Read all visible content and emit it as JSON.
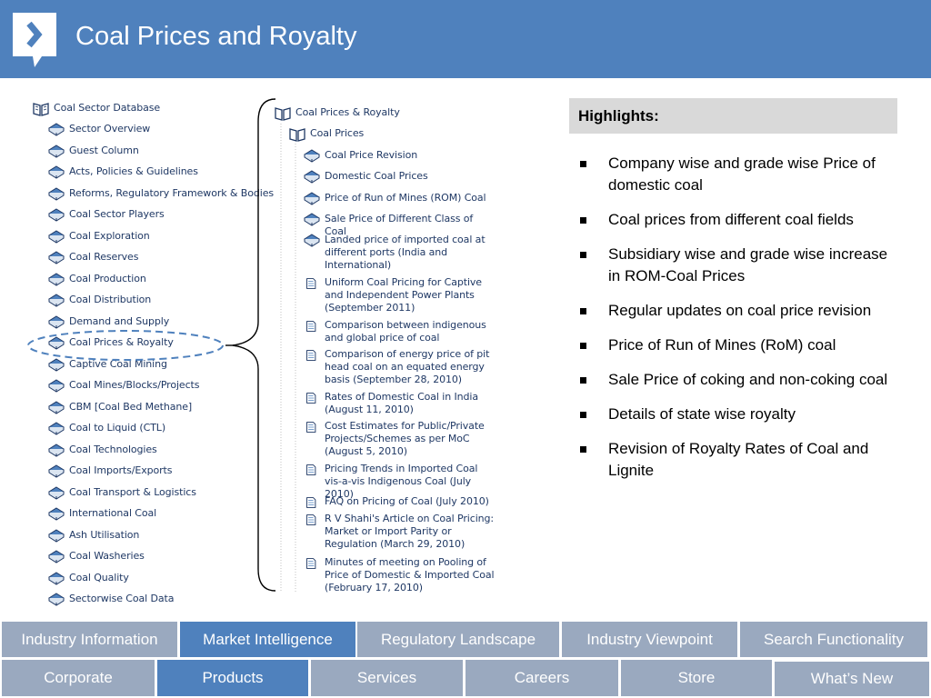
{
  "header": {
    "title": "Coal Prices and Royalty",
    "bg": "#4f81bd",
    "logo_icon": "chevron-right-speech-icon"
  },
  "left_tree": {
    "root": "Coal Sector Database",
    "items": [
      "Sector Overview",
      "Guest Column",
      "Acts, Policies & Guidelines",
      "Reforms, Regulatory Framework & Bodies",
      "Coal Sector Players",
      "Coal Exploration",
      "Coal Reserves",
      "Coal Production",
      "Coal Distribution",
      "Demand and Supply",
      "Coal Prices & Royalty",
      "Captive Coal Mining",
      "Coal Mines/Blocks/Projects",
      "CBM [Coal Bed Methane]",
      "Coal to Liquid (CTL)",
      "Coal Technologies",
      "Coal Imports/Exports",
      "Coal Transport & Logistics",
      "International Coal",
      "Ash Utilisation",
      "Coal Washeries",
      "Coal Quality",
      "Sectorwise Coal Data"
    ],
    "selected": "Coal Prices & Royalty"
  },
  "right_tree": {
    "root": "Coal Prices & Royalty",
    "sub": "Coal Prices",
    "books": [
      "Coal Price Revision",
      "Domestic Coal Prices",
      "Price of Run of Mines (ROM) Coal",
      "Sale Price of Different Class of Coal",
      "Landed price of imported coal at different ports (India and International)"
    ],
    "docs": [
      "Uniform Coal Pricing for Captive and Independent Power Plants (September 2011)",
      "Comparison between indigenous and global price of coal",
      "Comparison of energy price of pit head coal on an equated energy basis (September 28, 2010)",
      "Rates of Domestic Coal in India (August 11, 2010)",
      "Cost Estimates for Public/Private Projects/Schemes as per MoC (August 5, 2010)",
      "Pricing Trends in Imported Coal vis-a-vis Indigenous Coal (July 2010)",
      "FAQ on Pricing of Coal (July 2010)",
      "R V Shahi's Article on Coal Pricing: Market or Import Parity or Regulation (March 29, 2010)",
      "Minutes of meeting on Pooling of Price of Domestic & Imported Coal (February 17, 2010)"
    ]
  },
  "highlights": {
    "title": "Highlights:",
    "items": [
      "Company wise and grade wise Price of domestic coal",
      "Coal prices from different coal fields",
      "Subsidiary wise and grade wise increase in ROM-Coal Prices",
      "Regular updates on coal price revision",
      "Price of Run of Mines (RoM) coal",
      "Sale Price of coking and non-coking coal",
      "Details of state wise royalty",
      "Revision of Royalty Rates of Coal and Lignite"
    ]
  },
  "nav_row1": {
    "items": [
      "Industry Information",
      "Market Intelligence",
      "Regulatory Landscape",
      "Industry Viewpoint",
      "Search Functionality"
    ],
    "active": "Market Intelligence"
  },
  "nav_row2": {
    "items": [
      "Corporate",
      "Products",
      "Services",
      "Careers",
      "Store",
      "What’s New"
    ],
    "active": "Products"
  },
  "colors": {
    "accent": "#4f81bd",
    "inactive_tab": "#9aa9bf",
    "tree_text": "#1f3864"
  }
}
